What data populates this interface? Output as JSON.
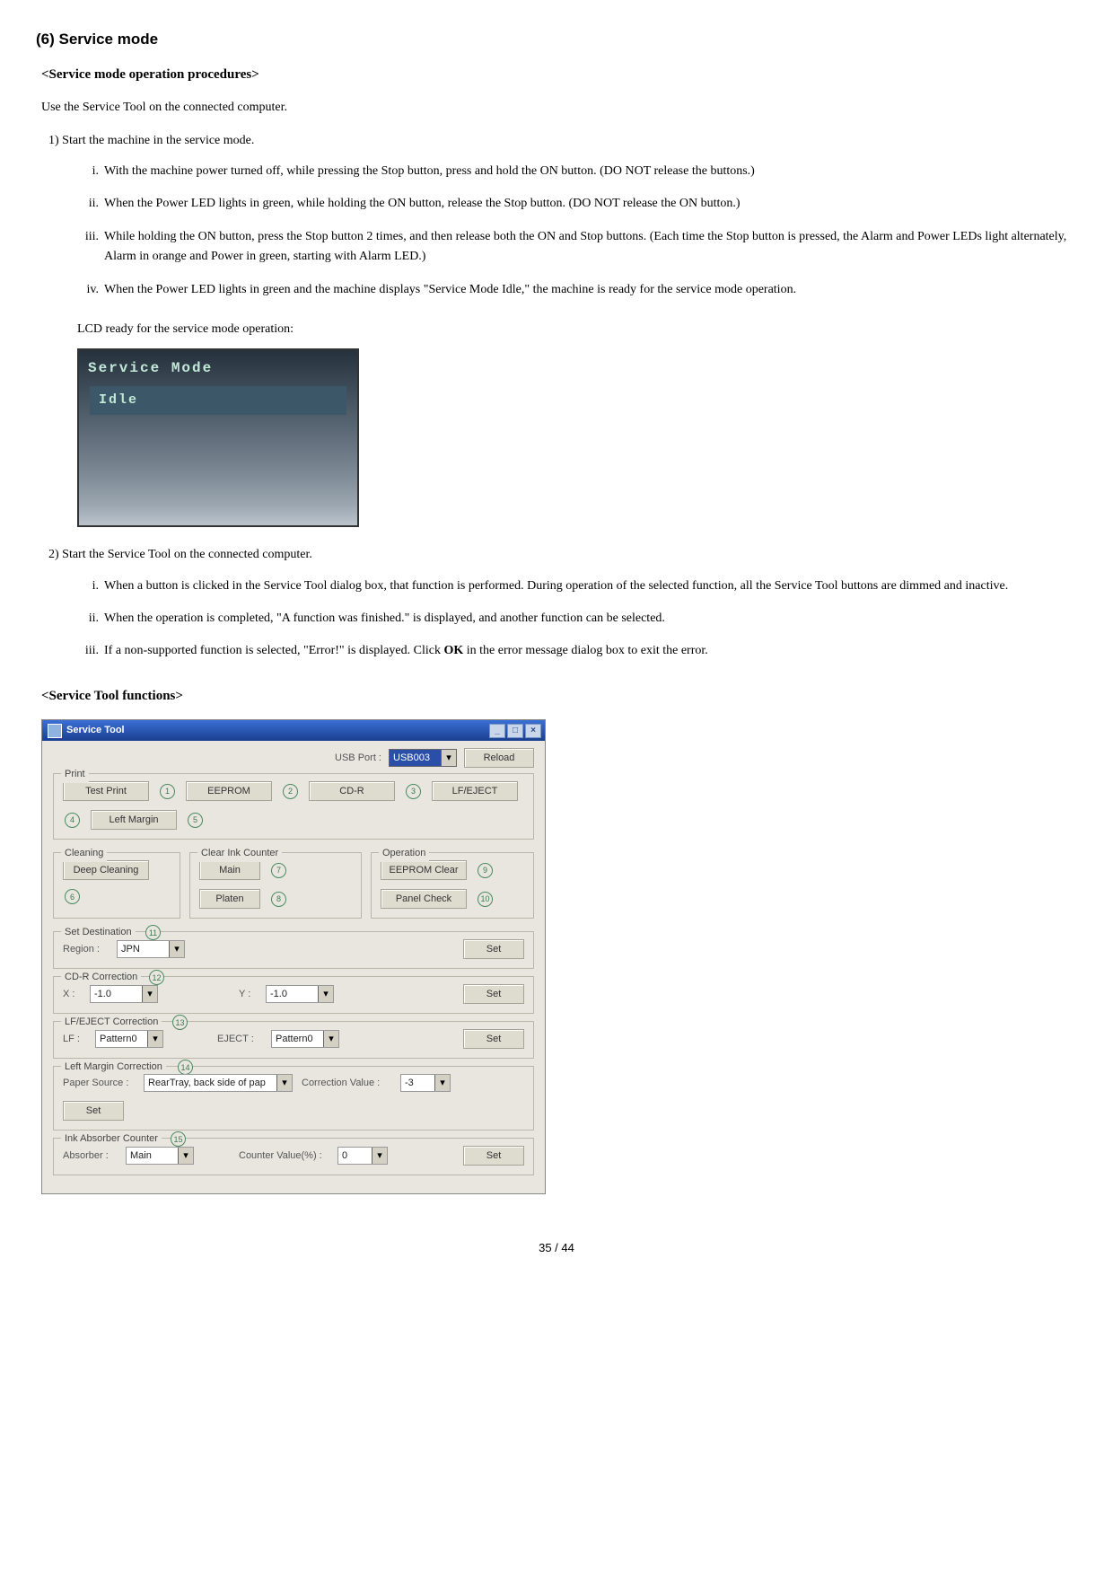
{
  "page": {
    "section_heading": "(6)  Service mode",
    "sub_heading_1": "<Service mode operation procedures>",
    "intro_text": "Use the Service Tool on the connected computer.",
    "step1_label": "1)",
    "step1_text": "Start the machine in the service mode.",
    "step1_items": {
      "i_label": "i.",
      "i_text": "With the machine power turned off, while pressing the Stop button, press and hold the ON button. (DO NOT release the buttons.)",
      "ii_label": "ii.",
      "ii_text": "When the Power LED lights in green, while holding the ON button, release the Stop button. (DO NOT release the ON button.)",
      "iii_label": "iii.",
      "iii_text": "While holding the ON button, press the Stop button 2 times, and then release both the ON and Stop buttons. (Each time the Stop button is pressed, the Alarm and Power LEDs light alternately, Alarm in orange and Power in green, starting with Alarm LED.)",
      "iv_label": "iv.",
      "iv_text": "When the Power LED lights in green and the machine displays \"Service Mode Idle,\" the machine is ready for the service mode operation."
    },
    "lcd_caption": "LCD ready for the service mode operation:",
    "lcd_title": "Service Mode",
    "lcd_status": "Idle",
    "step2_label": "2)",
    "step2_text": "Start the Service Tool on the connected computer.",
    "step2_items": {
      "i_label": "i.",
      "i_text": "When a button is clicked in the Service Tool dialog box, that function is performed. During operation of the selected function, all the Service Tool buttons are dimmed and inactive.",
      "ii_label": "ii.",
      "ii_text": "When the operation is completed, \"A function was finished.\" is displayed, and another function can be selected.",
      "iii_label": "iii.",
      "iii_text_before": "If a non-supported function is selected, \"Error!\" is displayed. Click ",
      "iii_text_bold": "OK",
      "iii_text_after": " in the error message dialog box to exit the error."
    },
    "sub_heading_2": "<Service Tool functions>",
    "page_number": "35 / 44"
  },
  "tool": {
    "title": "Service Tool",
    "usb_port_label": "USB Port :",
    "usb_port_value": "USB003",
    "reload": "Reload",
    "print": {
      "legend": "Print",
      "test_print": "Test Print",
      "eeprom": "EEPROM",
      "cdr": "CD-R",
      "lf_eject": "LF/EJECT",
      "left_margin": "Left Margin"
    },
    "cleaning_legend": "Cleaning",
    "deep_cleaning": "Deep Cleaning",
    "clear_ink_legend": "Clear Ink Counter",
    "clear_main": "Main",
    "clear_platen": "Platen",
    "operation_legend": "Operation",
    "eeprom_clear": "EEPROM Clear",
    "panel_check": "Panel Check",
    "set_dest_legend": "Set Destination",
    "region_label": "Region :",
    "region_value": "JPN",
    "set": "Set",
    "cdr_corr_legend": "CD-R Correction",
    "x_label": "X :",
    "x_value": "-1.0",
    "y_label": "Y :",
    "y_value": "-1.0",
    "lfeject_corr_legend": "LF/EJECT Correction",
    "lf_label": "LF :",
    "pattern0": "Pattern0",
    "eject_label": "EJECT :",
    "left_margin_corr_legend": "Left Margin Correction",
    "paper_source_label": "Paper Source :",
    "paper_source_value": "RearTray, back side of pap",
    "correction_value_label": "Correction Value :",
    "correction_value": "-3",
    "ink_abs_legend": "Ink Absorber Counter",
    "absorber_label": "Absorber :",
    "absorber_value": "Main",
    "counter_label": "Counter Value(%) :",
    "counter_value": "0",
    "badges": {
      "b1": "1",
      "b2": "2",
      "b3": "3",
      "b4": "4",
      "b5": "5",
      "b6": "6",
      "b7": "7",
      "b8": "8",
      "b9": "9",
      "b10": "10",
      "b11": "11",
      "b12": "12",
      "b13": "13",
      "b14": "14",
      "b15": "15"
    }
  }
}
